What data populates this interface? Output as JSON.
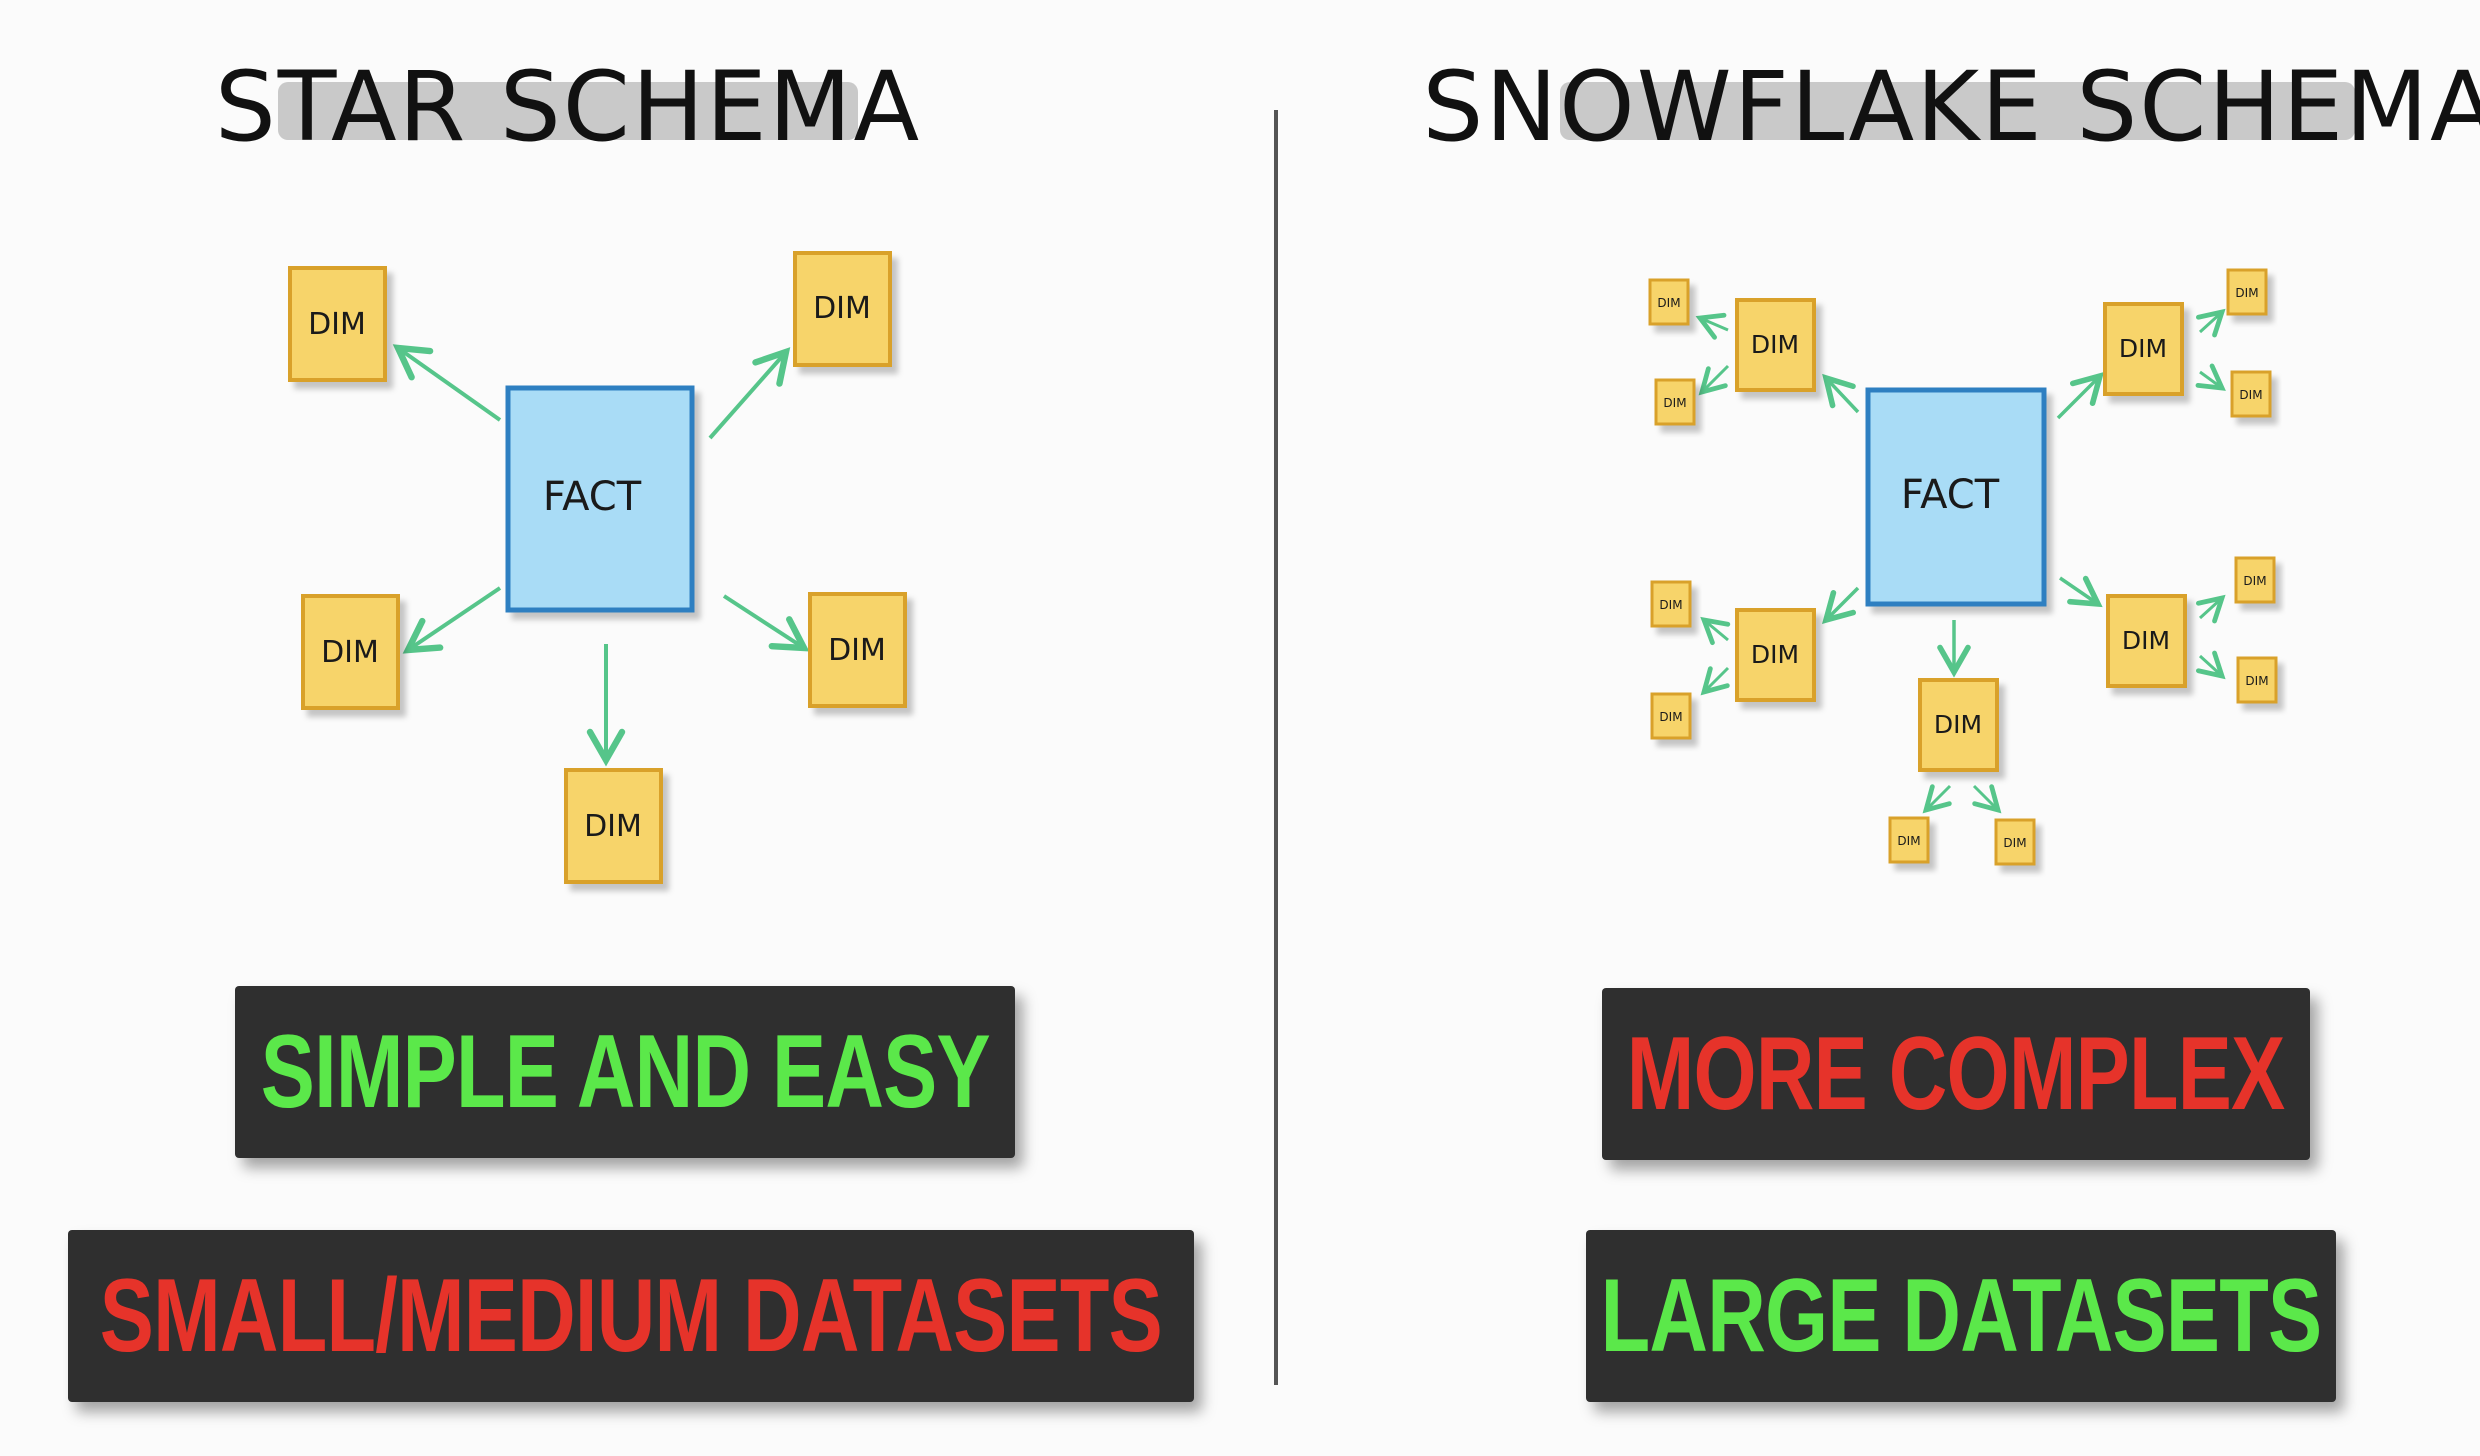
{
  "colors": {
    "background": "#fbfbfb",
    "divider": "#555555",
    "title_highlight": "#c9c9c9",
    "fact_fill": "#a9dcf6",
    "fact_stroke": "#2f7fc1",
    "dim_fill": "#f7d46b",
    "dim_stroke": "#d9a12a",
    "arrow": "#56c58a",
    "badge_bg": "#2f2f2f",
    "green_text": "#5be84a",
    "red_text": "#e6332a"
  },
  "star": {
    "title": "STAR SCHEMA",
    "fact_label": "FACT",
    "dim_label": "DIM",
    "badge_top": "SIMPLE AND EASY",
    "badge_bottom": "SMALL/MEDIUM DATASETS"
  },
  "snowflake": {
    "title": "SNOWFLAKE SCHEMA",
    "fact_label": "FACT",
    "dim_label": "DIM",
    "badge_top": "MORE COMPLEX",
    "badge_bottom": "LARGE DATASETS"
  }
}
